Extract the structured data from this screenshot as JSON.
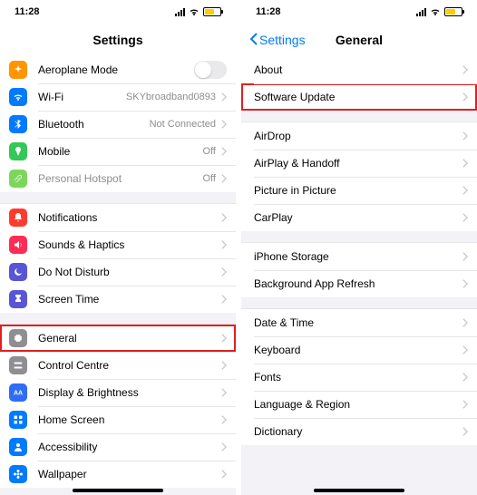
{
  "status": {
    "time": "11:28"
  },
  "left": {
    "title": "Settings",
    "groups": [
      [
        {
          "id": "aeroplane",
          "icon": "aeroplane-icon",
          "color": "c-orange",
          "label": "Aeroplane Mode",
          "toggle": true
        },
        {
          "id": "wifi",
          "icon": "wifi-icon",
          "color": "c-blue",
          "label": "Wi-Fi",
          "detail": "SKYbroadband0893"
        },
        {
          "id": "bluetooth",
          "icon": "bluetooth-icon",
          "color": "c-blue",
          "label": "Bluetooth",
          "detail": "Not Connected"
        },
        {
          "id": "mobile",
          "icon": "antenna-icon",
          "color": "c-green",
          "label": "Mobile",
          "detail": "Off"
        },
        {
          "id": "hotspot",
          "icon": "link-icon",
          "color": "c-lgreen",
          "label": "Personal Hotspot",
          "detail": "Off",
          "muted": true
        }
      ],
      [
        {
          "id": "notifications",
          "icon": "bell-icon",
          "color": "c-red",
          "label": "Notifications"
        },
        {
          "id": "sounds",
          "icon": "speaker-icon",
          "color": "c-pink",
          "label": "Sounds & Haptics"
        },
        {
          "id": "dnd",
          "icon": "moon-icon",
          "color": "c-purple",
          "label": "Do Not Disturb"
        },
        {
          "id": "screentime",
          "icon": "hourglass-icon",
          "color": "c-purple",
          "label": "Screen Time"
        }
      ],
      [
        {
          "id": "general",
          "icon": "gear-icon",
          "color": "c-gray",
          "label": "General",
          "highlight": true
        },
        {
          "id": "control",
          "icon": "switches-icon",
          "color": "c-gray",
          "label": "Control Centre"
        },
        {
          "id": "display",
          "icon": "aa-icon",
          "color": "c-aa",
          "label": "Display & Brightness"
        },
        {
          "id": "home",
          "icon": "grid-icon",
          "color": "c-blue",
          "label": "Home Screen"
        },
        {
          "id": "accessibility",
          "icon": "person-icon",
          "color": "c-blue",
          "label": "Accessibility"
        },
        {
          "id": "wallpaper",
          "icon": "flower-icon",
          "color": "c-blue",
          "label": "Wallpaper"
        }
      ]
    ]
  },
  "right": {
    "back": "Settings",
    "title": "General",
    "groups": [
      [
        {
          "id": "about",
          "label": "About"
        },
        {
          "id": "software-update",
          "label": "Software Update",
          "highlight": true
        }
      ],
      [
        {
          "id": "airdrop",
          "label": "AirDrop"
        },
        {
          "id": "airplay",
          "label": "AirPlay & Handoff"
        },
        {
          "id": "pip",
          "label": "Picture in Picture"
        },
        {
          "id": "carplay",
          "label": "CarPlay"
        }
      ],
      [
        {
          "id": "storage",
          "label": "iPhone Storage"
        },
        {
          "id": "background",
          "label": "Background App Refresh"
        }
      ],
      [
        {
          "id": "datetime",
          "label": "Date & Time"
        },
        {
          "id": "keyboard",
          "label": "Keyboard"
        },
        {
          "id": "fonts",
          "label": "Fonts"
        },
        {
          "id": "language",
          "label": "Language & Region"
        },
        {
          "id": "dictionary",
          "label": "Dictionary"
        }
      ]
    ]
  }
}
